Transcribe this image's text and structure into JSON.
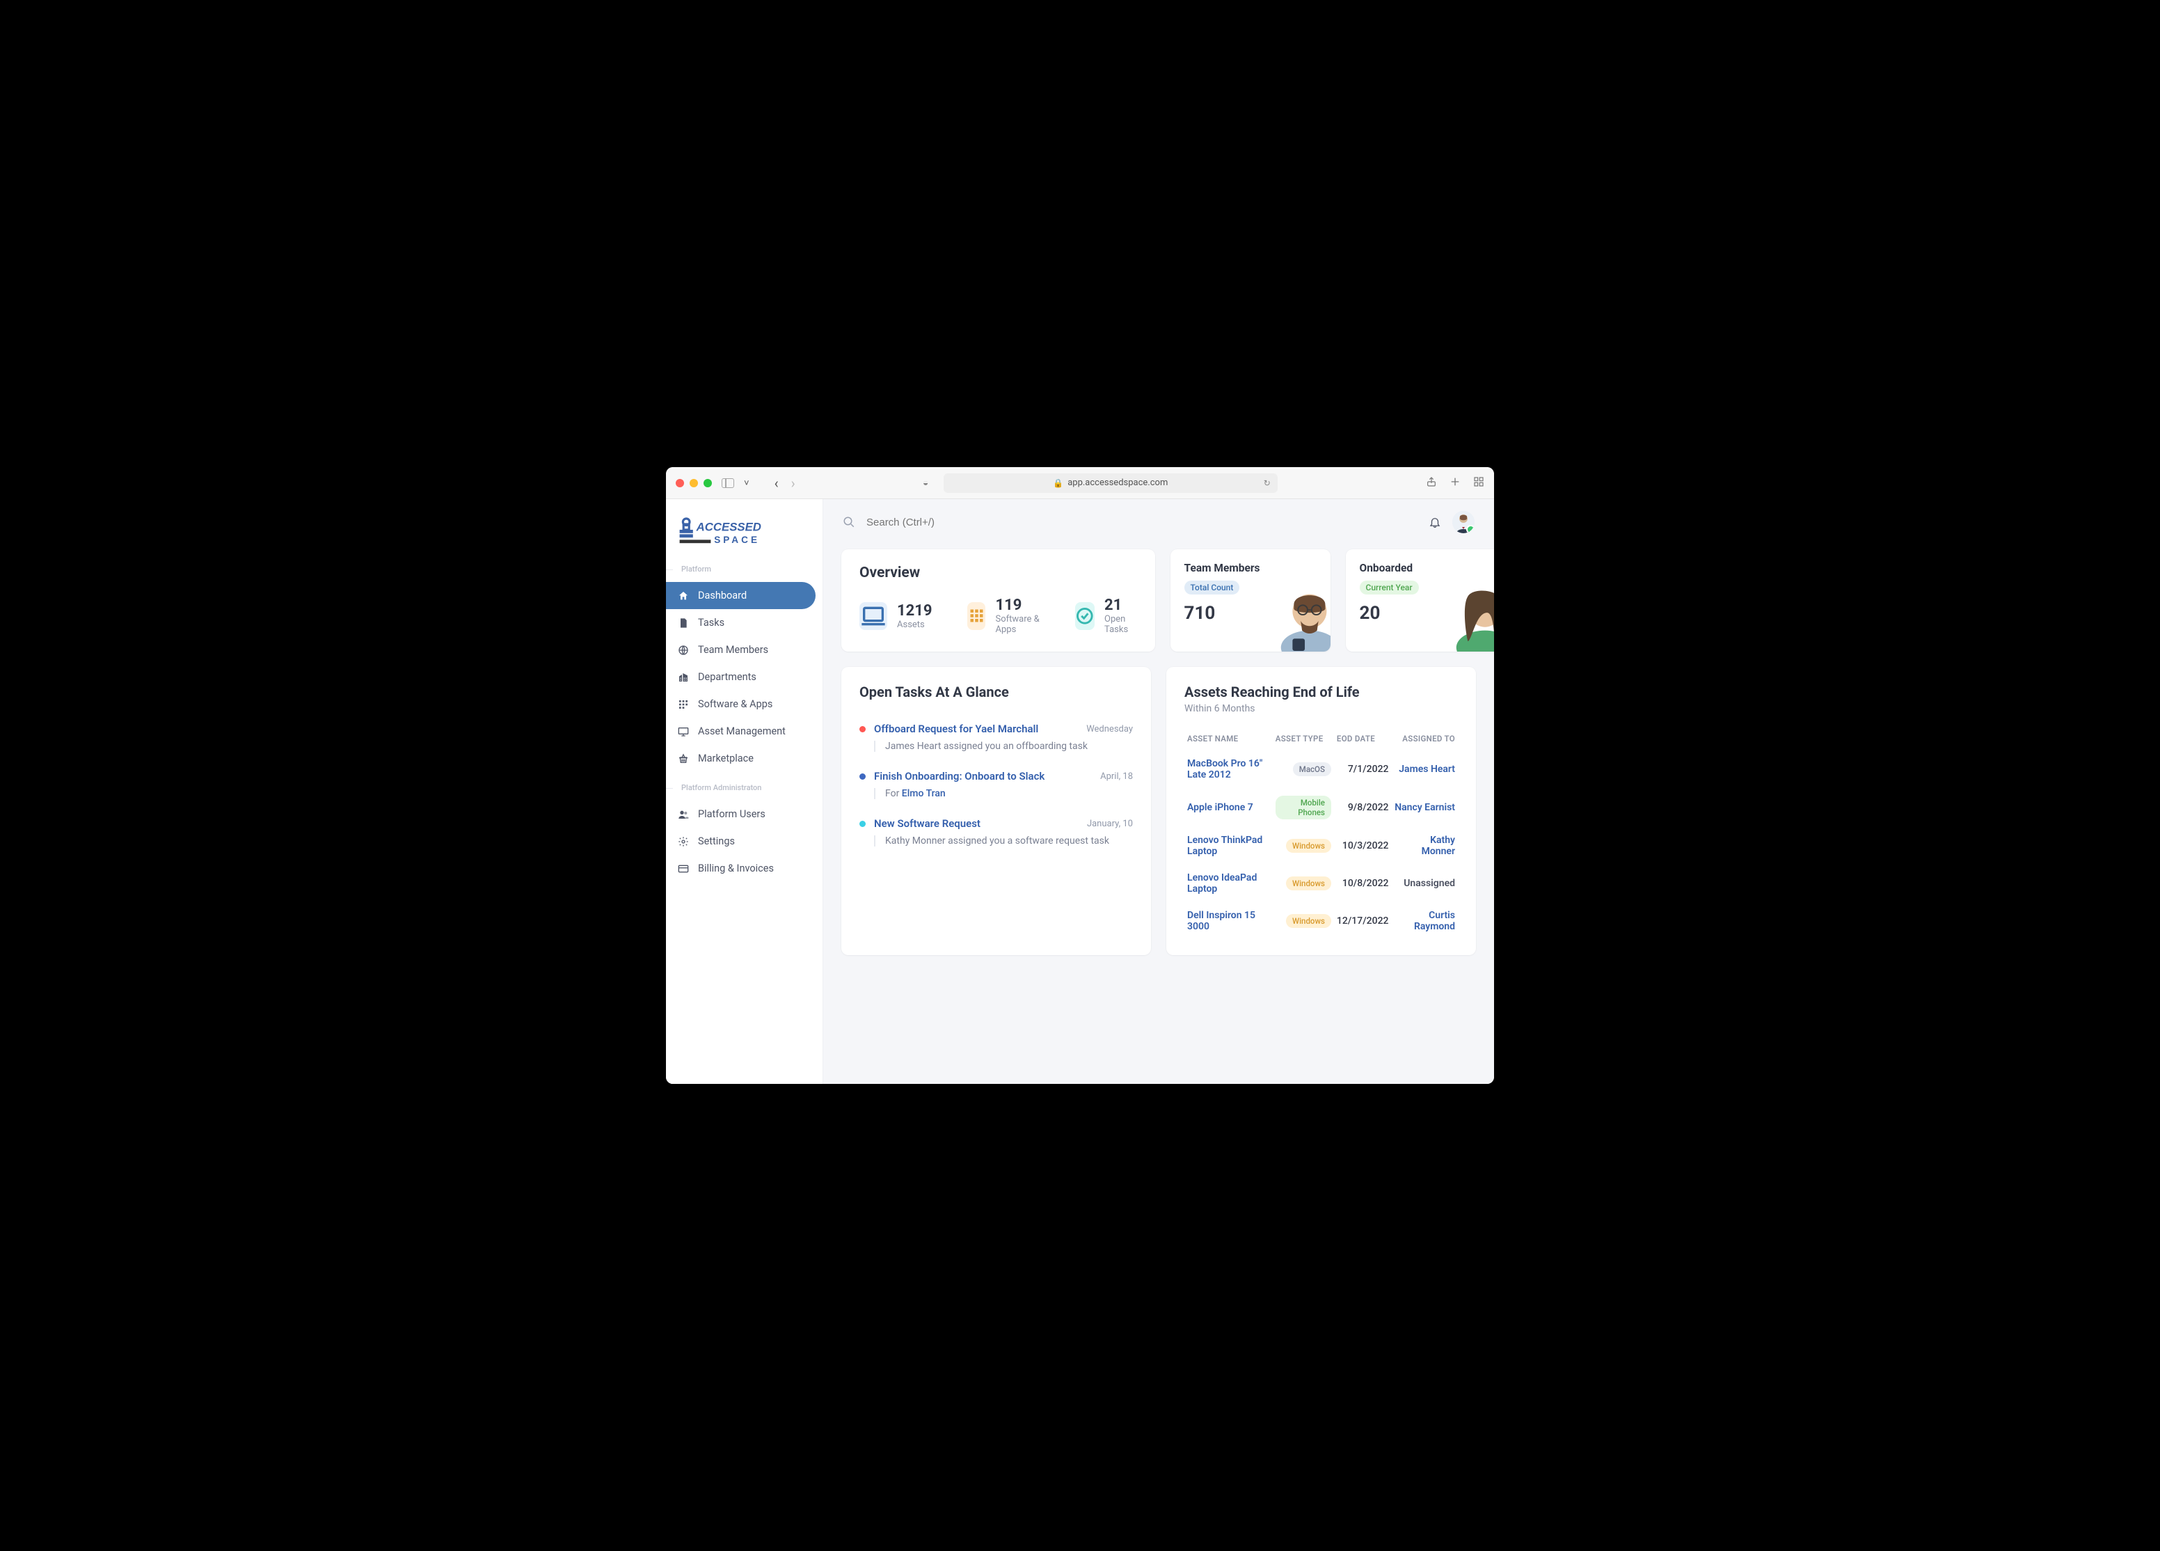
{
  "browser": {
    "url": "app.accessedspace.com"
  },
  "brand": {
    "name_top": "ACCESSED",
    "name_bottom": "SPACE",
    "color": "#3a62a8"
  },
  "search": {
    "placeholder": "Search (Ctrl+/)"
  },
  "sidebar": {
    "sections": [
      {
        "heading": "Platform",
        "items": [
          {
            "icon": "home-icon",
            "label": "Dashboard",
            "active": true
          },
          {
            "icon": "tasks-icon",
            "label": "Tasks"
          },
          {
            "icon": "globe-icon",
            "label": "Team Members"
          },
          {
            "icon": "building-icon",
            "label": "Departments"
          },
          {
            "icon": "apps-icon",
            "label": "Software & Apps"
          },
          {
            "icon": "monitor-icon",
            "label": "Asset Management"
          },
          {
            "icon": "basket-icon",
            "label": "Marketplace"
          }
        ]
      },
      {
        "heading": "Platform Administraton",
        "items": [
          {
            "icon": "users-icon",
            "label": "Platform Users"
          },
          {
            "icon": "gear-icon",
            "label": "Settings"
          },
          {
            "icon": "card-icon",
            "label": "Billing & Invoices"
          }
        ]
      }
    ]
  },
  "overview": {
    "title": "Overview",
    "stats": [
      {
        "value": "1219",
        "label": "Assets",
        "color": "blue"
      },
      {
        "value": "119",
        "label": "Software & Apps",
        "color": "orange"
      },
      {
        "value": "21",
        "label": "Open Tasks",
        "color": "teal"
      }
    ]
  },
  "team_members_card": {
    "title": "Team Members",
    "pill": "Total Count",
    "value": "710"
  },
  "onboarded_card": {
    "title": "Onboarded",
    "pill": "Current Year",
    "value": "20"
  },
  "open_tasks": {
    "title": "Open Tasks At A Glance",
    "tasks": [
      {
        "color": "red",
        "title": "Offboard Request for Yael Marchall",
        "time": "Wednesday",
        "sub_prefix": "James Heart assigned you an offboarding task",
        "sub_link": ""
      },
      {
        "color": "dblue",
        "title": "Finish Onboarding: Onboard to Slack",
        "time": "April, 18",
        "sub_prefix": "For ",
        "sub_link": "Elmo Tran"
      },
      {
        "color": "cyan",
        "title": "New Software Request",
        "time": "January, 10",
        "sub_prefix": "Kathy Monner assigned you a software request task",
        "sub_link": ""
      }
    ]
  },
  "eol": {
    "title": "Assets Reaching End of Life",
    "subtitle": "Within 6 Months",
    "columns": [
      "ASSET NAME",
      "ASSET TYPE",
      "EOD DATE",
      "ASSIGNED TO"
    ],
    "rows": [
      {
        "name": "MacBook Pro 16\" Late 2012",
        "type": "MacOS",
        "type_class": "macos",
        "date": "7/1/2022",
        "assigned": "James Heart",
        "assigned_link": true
      },
      {
        "name": "Apple iPhone 7",
        "type": "Mobile Phones",
        "type_class": "phone",
        "date": "9/8/2022",
        "assigned": "Nancy Earnist",
        "assigned_link": true
      },
      {
        "name": "Lenovo ThinkPad Laptop",
        "type": "Windows",
        "type_class": "win",
        "date": "10/3/2022",
        "assigned": "Kathy Monner",
        "assigned_link": true
      },
      {
        "name": "Lenovo IdeaPad Laptop",
        "type": "Windows",
        "type_class": "win",
        "date": "10/8/2022",
        "assigned": "Unassigned",
        "assigned_link": false
      },
      {
        "name": "Dell Inspiron 15 3000",
        "type": "Windows",
        "type_class": "win",
        "date": "12/17/2022",
        "assigned": "Curtis Raymond",
        "assigned_link": true
      }
    ]
  }
}
